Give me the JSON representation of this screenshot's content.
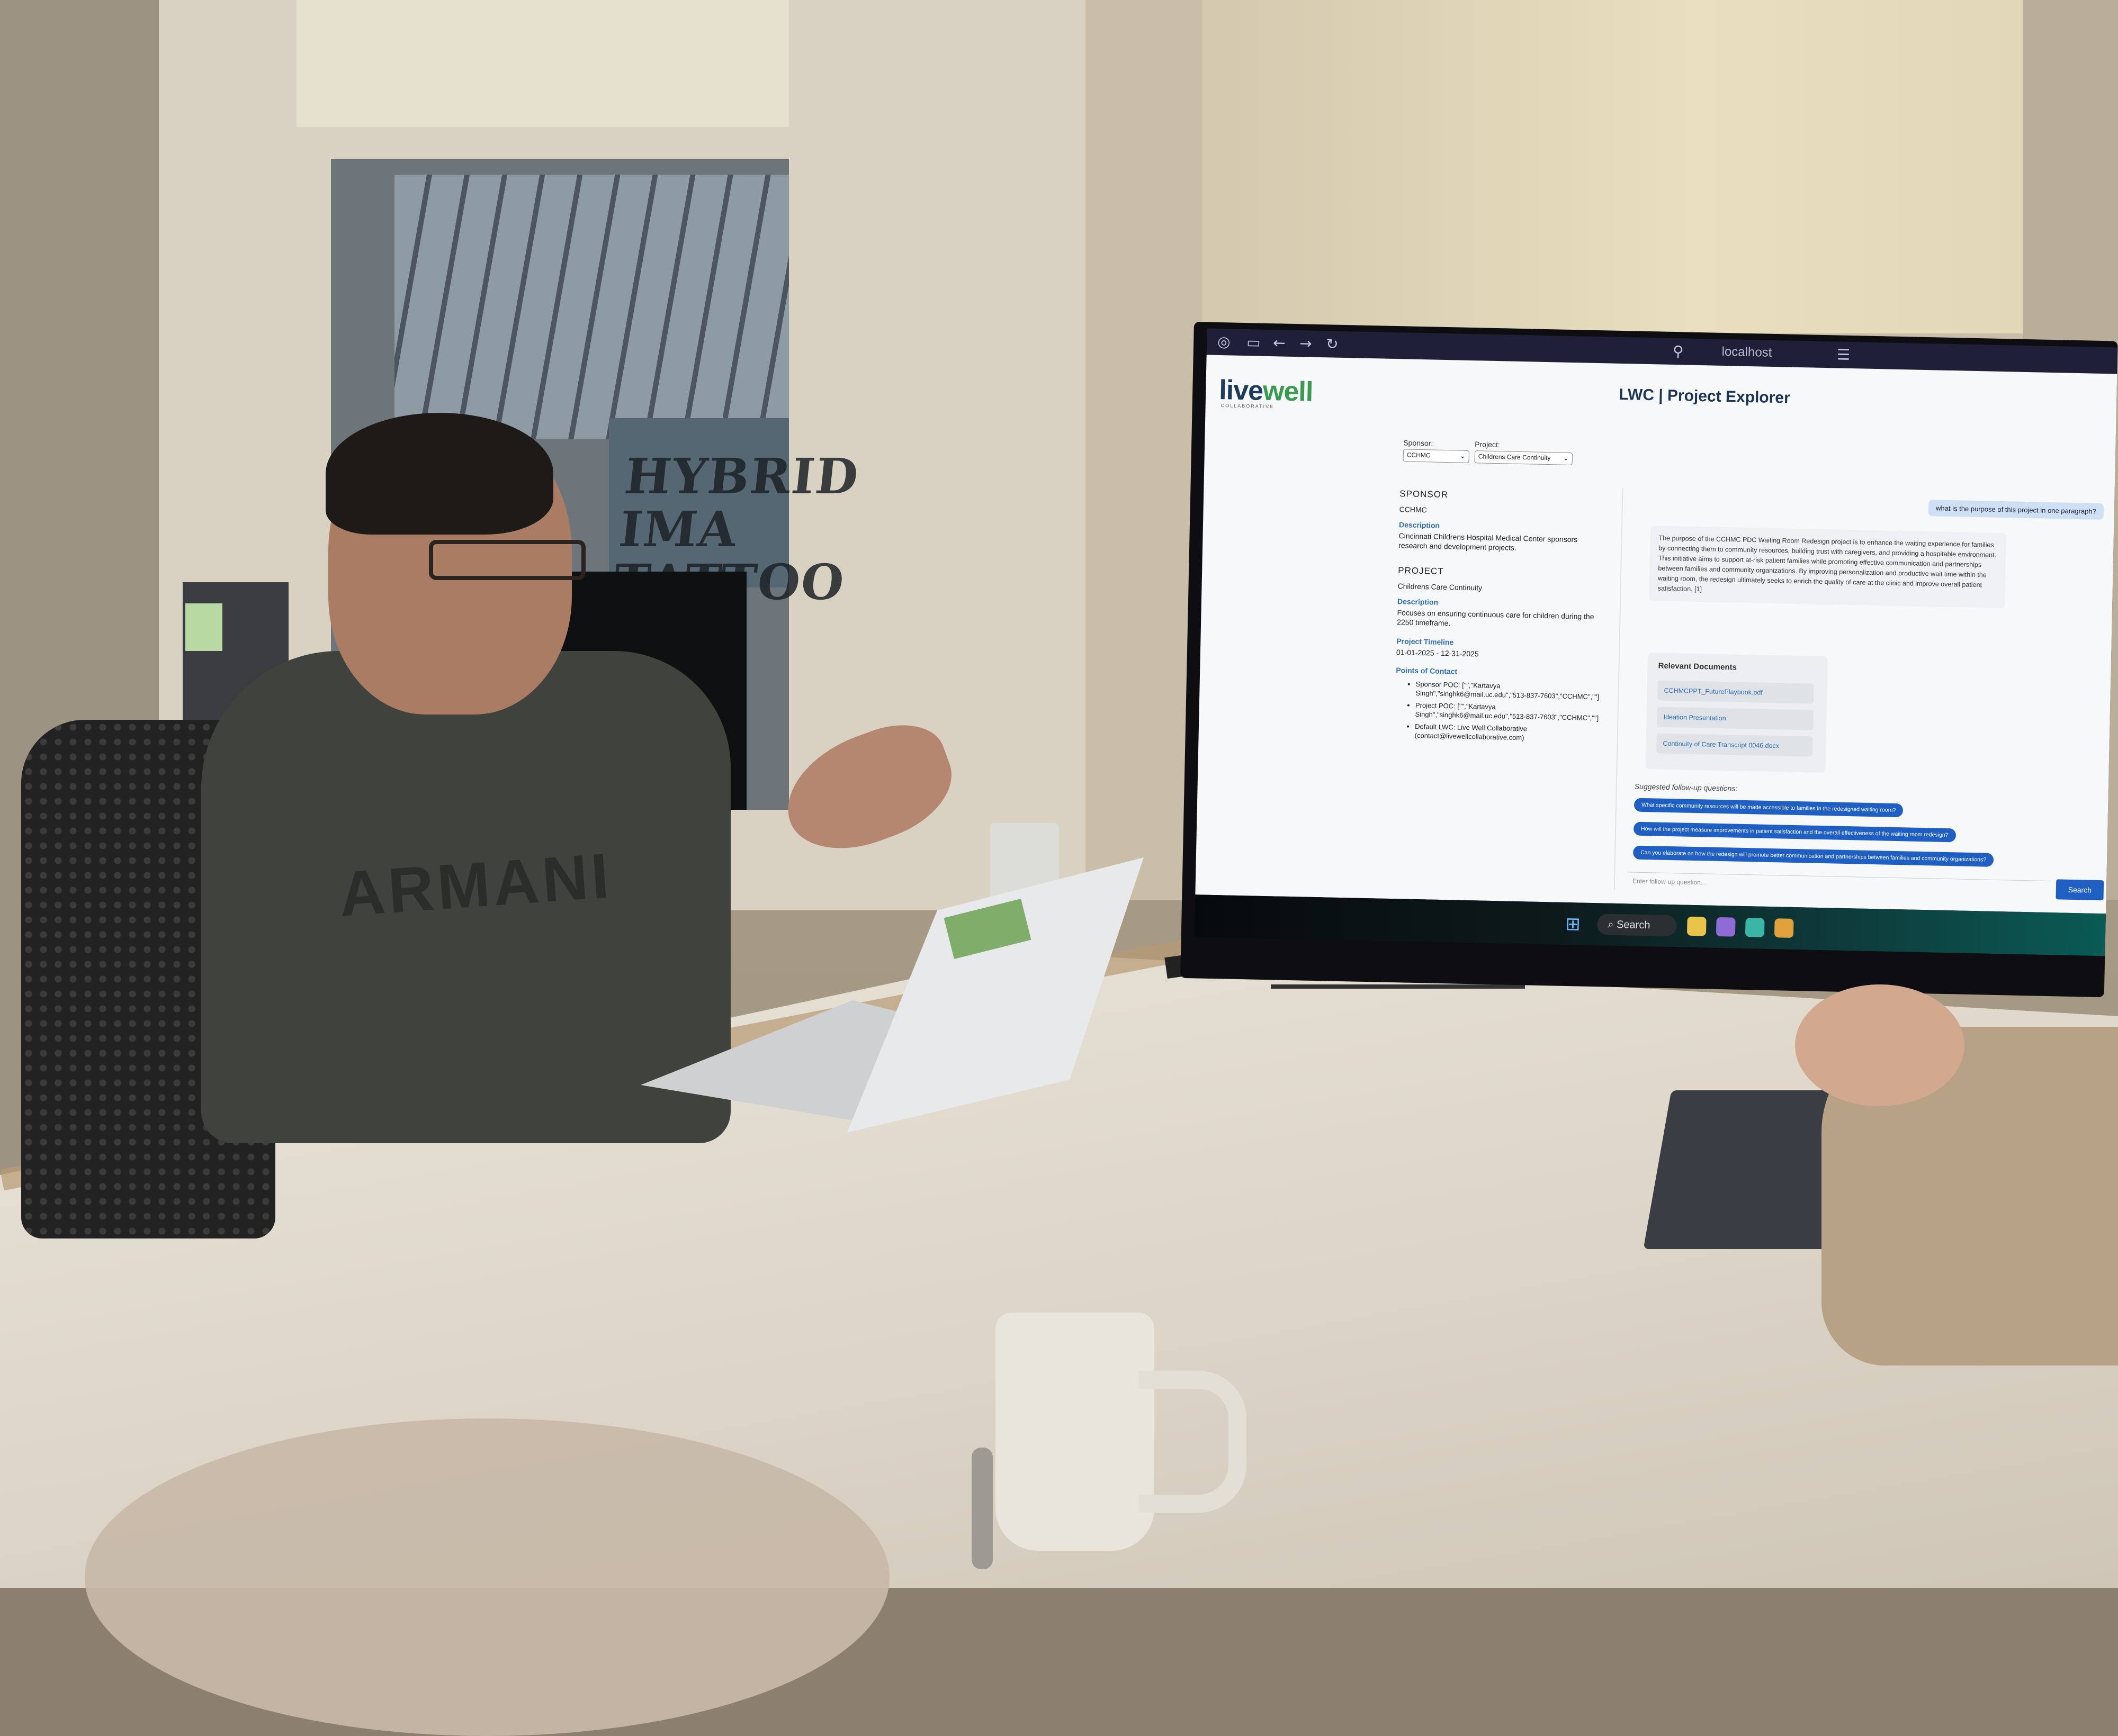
{
  "scene": {
    "window_sign_text": "HYBRID IMA TATTOO",
    "hoodie_text": "ARMANI"
  },
  "browser": {
    "url_text": "localhost"
  },
  "app": {
    "logo_text_live": "live",
    "logo_text_well": "well",
    "logo_subtitle": "COLLABORATIVE",
    "title": "LWC | Project Explorer",
    "sponsor_label": "Sponsor:",
    "sponsor_value": "CCHMC",
    "project_label": "Project:",
    "project_value": "Childrens Care Continuity"
  },
  "left_panel": {
    "sponsor_heading": "SPONSOR",
    "sponsor_name": "CCHMC",
    "sponsor_desc_label": "Description",
    "sponsor_desc": "Cincinnati Childrens Hospital Medical Center sponsors research and development projects.",
    "project_heading": "PROJECT",
    "project_name": "Childrens Care Continuity",
    "project_desc_label": "Description",
    "project_desc": "Focuses on ensuring continuous care for children during the 2250 timeframe.",
    "timeline_label": "Project Timeline",
    "timeline_value": "01-01-2025 - 12-31-2025",
    "contacts_label": "Points of Contact",
    "contacts": [
      "Sponsor POC: [\"\",\"Kartavya Singh\",\"singhk6@mail.uc.edu\",\"513-837-7603\",\"CCHMC\",\"\"]",
      "Project POC: [\"\",\"Kartavya Singh\",\"singhk6@mail.uc.edu\",\"513-837-7603\",\"CCHMC\",\"\"]",
      "Default LWC: Live Well Collaborative (contact@livewellcollaborative.com)"
    ]
  },
  "chat": {
    "user_message": "what is the purpose of this project in one paragraph?",
    "bot_message": "The purpose of the CCHMC PDC Waiting Room Redesign project is to enhance the waiting experience for families by connecting them to community resources, building trust with caregivers, and providing a hospitable environment. This initiative aims to support at-risk patient families while promoting effective communication and partnerships between families and community organizations. By improving personalization and productive wait time within the waiting room, the redesign ultimately seeks to enrich the quality of care at the clinic and improve overall patient satisfaction. [1]",
    "docs_title": "Relevant Documents",
    "documents": [
      "CCHMCPPT_FuturePlaybook.pdf",
      "Ideation Presentation",
      "Continuity of Care Transcript 0046.docx"
    ],
    "followup_title": "Suggested follow-up questions:",
    "followups": [
      "What specific community resources will be made accessible to families in the redesigned waiting room?",
      "How will the project measure improvements in patient satisfaction and the overall effectiveness of the waiting room redesign?",
      "Can you elaborate on how the redesign will promote better communication and partnerships between families and community organizations?"
    ],
    "input_placeholder": "Enter follow-up question...",
    "search_label": "Search"
  },
  "taskbar": {
    "search_label": "Search"
  }
}
